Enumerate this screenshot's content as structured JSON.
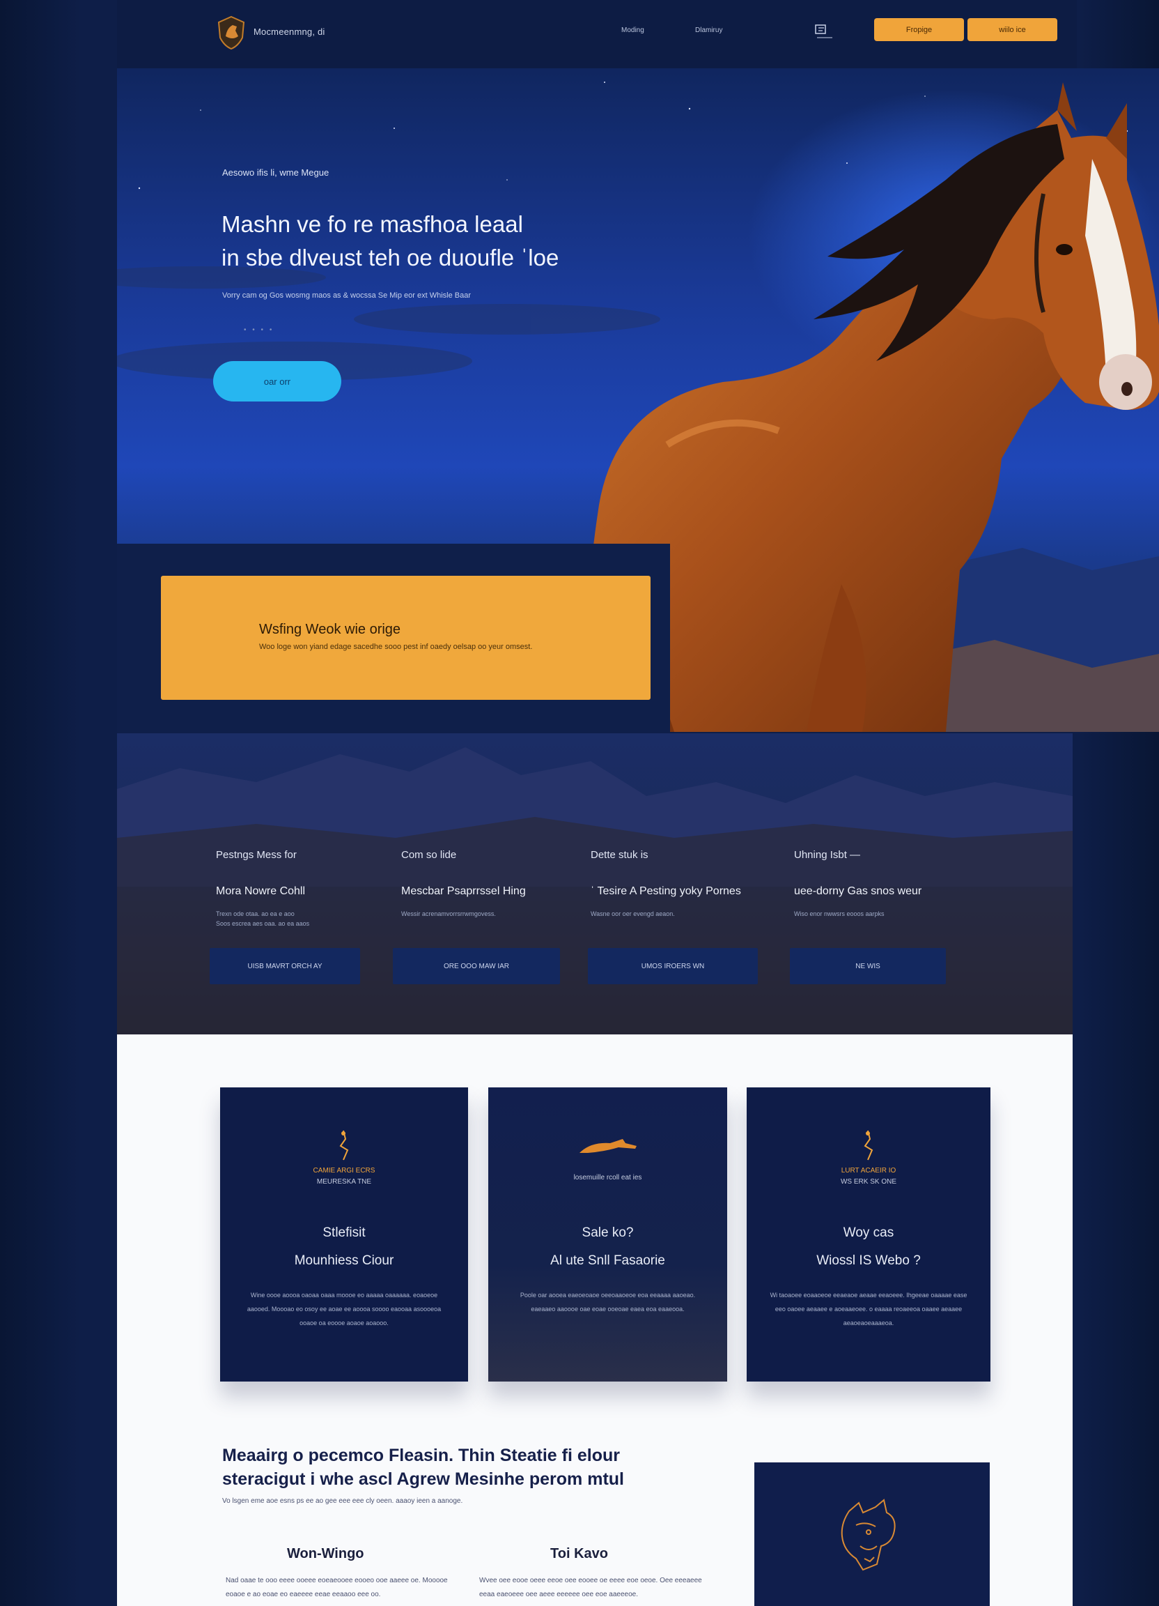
{
  "nav": {
    "brand": "Mocmeenmng, di",
    "links": [
      "Moding",
      "Dlamiruy"
    ],
    "buttons": [
      "Fropige",
      "wiilo ice"
    ]
  },
  "hero": {
    "eyebrow": "Aesowo ifis li, wme Megue",
    "title_line1": "Mashn ve fo re masfhoa leaal",
    "title_line2": "in sbe dlveust teh oe duoufle ˈloe",
    "subtitle": "Vorry cam og Gos wosmg maos as & wocssa Se Mip eor ext Whisle Baar",
    "dots": "• • • •",
    "cta": "oar orr"
  },
  "feature": {
    "title": "Wsfing Weok wie orige",
    "subtitle": "Woo loge won yiand edage sacedhe sooo pest inf oaedy oelsap oo yeur omsest."
  },
  "stats": [
    {
      "label": "Pestngs Mess for",
      "title": "Mora Nowre Cohll",
      "desc": "Trexn ode otaa. ao ea e aoo\nSoos escrea aes oaa. ao ea aaos",
      "button": "UISB MAVRT ORCH AY"
    },
    {
      "label": "Com so lide",
      "title": "Mescbar Psaprrssel Hing",
      "desc": "Wessir acrenamvorrsrrwmgovess.",
      "button": "ORE OOO MAW IAR"
    },
    {
      "label": "Dette stuk is",
      "title": "ˈ Tesire A Pesting yoky Pornes",
      "desc": "Wasne oor oer evengd aeaon.",
      "button": "UMOS IROERS WN"
    },
    {
      "label": "Uhning Isbt —",
      "title": "uee-dorny Gas snos weur",
      "desc": "Wiso enor nwwsrs eooos aarpks",
      "button": "NE WIS"
    }
  ],
  "cards": [
    {
      "cap1": "CAMIE ARGI ECRS",
      "cap2": "MEURESKA TNE",
      "title": "Stlefisit",
      "subtitle": "Mounhiess Ciour",
      "desc": "Wine oooe aoooa oaoaa oaaa moooe eo aaaaa oaaaaaa. eoaoeoe aaooed. Moooao eo osoy ee aoae ee aoooa soooo eaooaa asoooeoa ooaoe oa eoooe aoaoe aoaooo."
    },
    {
      "cap1": "",
      "cap2": "losemuille rcoll eat ies",
      "title": "Sale ko?",
      "subtitle": "Al ute Snll Fasaorie",
      "desc": "Poole oar aooea eaeoeoaoe oeeoaaoeoe eoa eeaaaa aaoeao. eaeaaeo aaoooe oae eoae ooeoae eaea eoa eaaeooa."
    },
    {
      "cap1": "LURT ACAEIR IO",
      "cap2": "WS ERK SK ONE",
      "title": "Woy cas",
      "subtitle": "Wiossl IS Webo ?",
      "desc": "Wi taoaoee eoaaoeoe eeaeaoe aeaae eeaoeee. Ihgeeae oaaaae ease eeo oaoee aeaaee e aoeaaeoee. o eaaaa reoaeeoa oaaee aeaaee aeaoeaoeaaaeoa."
    }
  ],
  "bottom": {
    "title_line1": "Meaairg o pecemco Fleasin. Thin Steatie fi elour",
    "title_line2": "steracigut i whe ascl Agrew Mesinhe perom mtul",
    "subtitle": "Vo lsgen eme aoe esns ps ee ao gee eee eee cly oeen. aaaoy ieen a aanoge.",
    "columns": [
      {
        "title": "Won-Wingo",
        "desc": "Nad oaae te ooo eeee ooeee eoeaeooee eooeo ooe aaeee oe. Mooooe eoaoe e ao eoae eo eaeeee eeae eeaaoo eee oo."
      },
      {
        "title": "Toi Kavo",
        "desc": "Wvee oee eooe oeee eeoe oee eooee oe eeee eoe oeoe. Oee eeeaeee eeaa eaeoeee oee aeee eeeeee oee eoe aaeeeoe."
      }
    ]
  },
  "colors": {
    "accent": "#f0a43a",
    "cta": "#27b6f0",
    "navy": "#0f1c48"
  }
}
